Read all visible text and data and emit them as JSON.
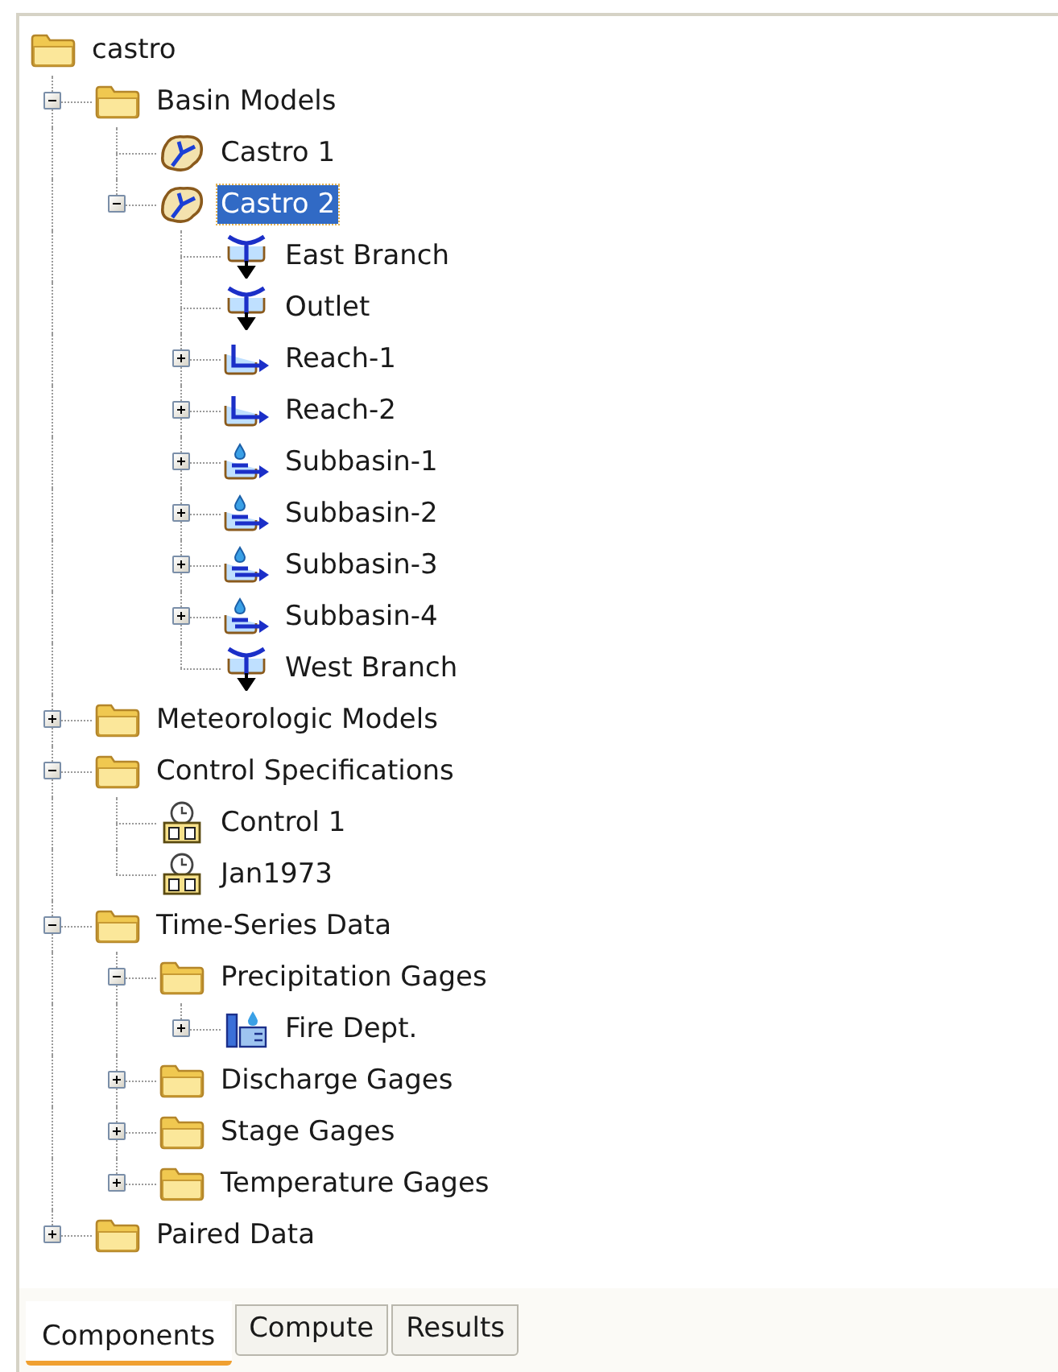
{
  "tree": [
    {
      "label": "castro",
      "kind": "folder",
      "selected": false,
      "children": [
        {
          "label": "Basin Models",
          "kind": "folder",
          "selected": false,
          "expanded": true,
          "children": [
            {
              "label": "Castro 1",
              "kind": "basin",
              "selected": false
            },
            {
              "label": "Castro 2",
              "kind": "basin",
              "selected": true,
              "expanded": true,
              "children": [
                {
                  "label": "East Branch",
                  "kind": "junction",
                  "selected": false
                },
                {
                  "label": "Outlet",
                  "kind": "junction",
                  "selected": false
                },
                {
                  "label": "Reach-1",
                  "kind": "reach",
                  "selected": false,
                  "expanded": false
                },
                {
                  "label": "Reach-2",
                  "kind": "reach",
                  "selected": false,
                  "expanded": false
                },
                {
                  "label": "Subbasin-1",
                  "kind": "subbasin",
                  "selected": false,
                  "expanded": false
                },
                {
                  "label": "Subbasin-2",
                  "kind": "subbasin",
                  "selected": false,
                  "expanded": false
                },
                {
                  "label": "Subbasin-3",
                  "kind": "subbasin",
                  "selected": false,
                  "expanded": false
                },
                {
                  "label": "Subbasin-4",
                  "kind": "subbasin",
                  "selected": false,
                  "expanded": false
                },
                {
                  "label": "West Branch",
                  "kind": "junction",
                  "selected": false
                }
              ]
            }
          ]
        },
        {
          "label": "Meteorologic Models",
          "kind": "folder",
          "selected": false,
          "expanded": false
        },
        {
          "label": "Control Specifications",
          "kind": "folder",
          "selected": false,
          "expanded": true,
          "children": [
            {
              "label": "Control 1",
              "kind": "control",
              "selected": false
            },
            {
              "label": "Jan1973",
              "kind": "control",
              "selected": false
            }
          ]
        },
        {
          "label": "Time-Series Data",
          "kind": "folder",
          "selected": false,
          "expanded": true,
          "children": [
            {
              "label": "Precipitation Gages",
              "kind": "folder",
              "selected": false,
              "expanded": true,
              "children": [
                {
                  "label": "Fire Dept.",
                  "kind": "gage",
                  "selected": false,
                  "expanded": false
                }
              ]
            },
            {
              "label": "Discharge Gages",
              "kind": "folder",
              "selected": false,
              "expanded": false
            },
            {
              "label": "Stage Gages",
              "kind": "folder",
              "selected": false,
              "expanded": false
            },
            {
              "label": "Temperature Gages",
              "kind": "folder",
              "selected": false,
              "expanded": false
            }
          ]
        },
        {
          "label": "Paired Data",
          "kind": "folder",
          "selected": false,
          "expanded": false
        }
      ]
    }
  ],
  "tabs": [
    {
      "label": "Components",
      "selected": true
    },
    {
      "label": "Compute",
      "selected": false
    },
    {
      "label": "Results",
      "selected": false
    }
  ]
}
